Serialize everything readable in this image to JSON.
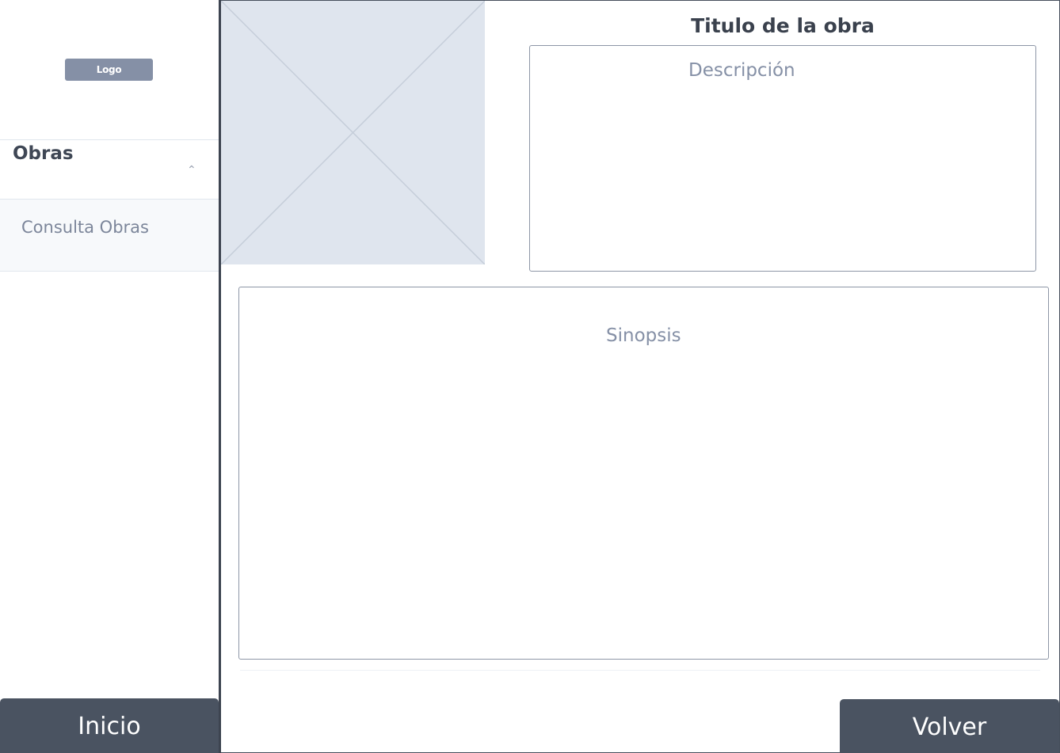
{
  "sidebar": {
    "logo_label": "Logo",
    "section_header": "Obras",
    "items": [
      {
        "label": "Consulta Obras"
      }
    ],
    "home_button_label": "Inicio"
  },
  "main": {
    "image_alt": "",
    "title": "Titulo de la obra",
    "description_placeholder": "Descripción",
    "synopsis_placeholder": "Sinopsis",
    "back_button_label": "Volver"
  },
  "colors": {
    "button_bg": "#4a5361",
    "logo_bg": "#8590a6",
    "placeholder_bg": "#dfe5ee"
  },
  "icons": {
    "section_toggle": "chevron-up-icon"
  }
}
